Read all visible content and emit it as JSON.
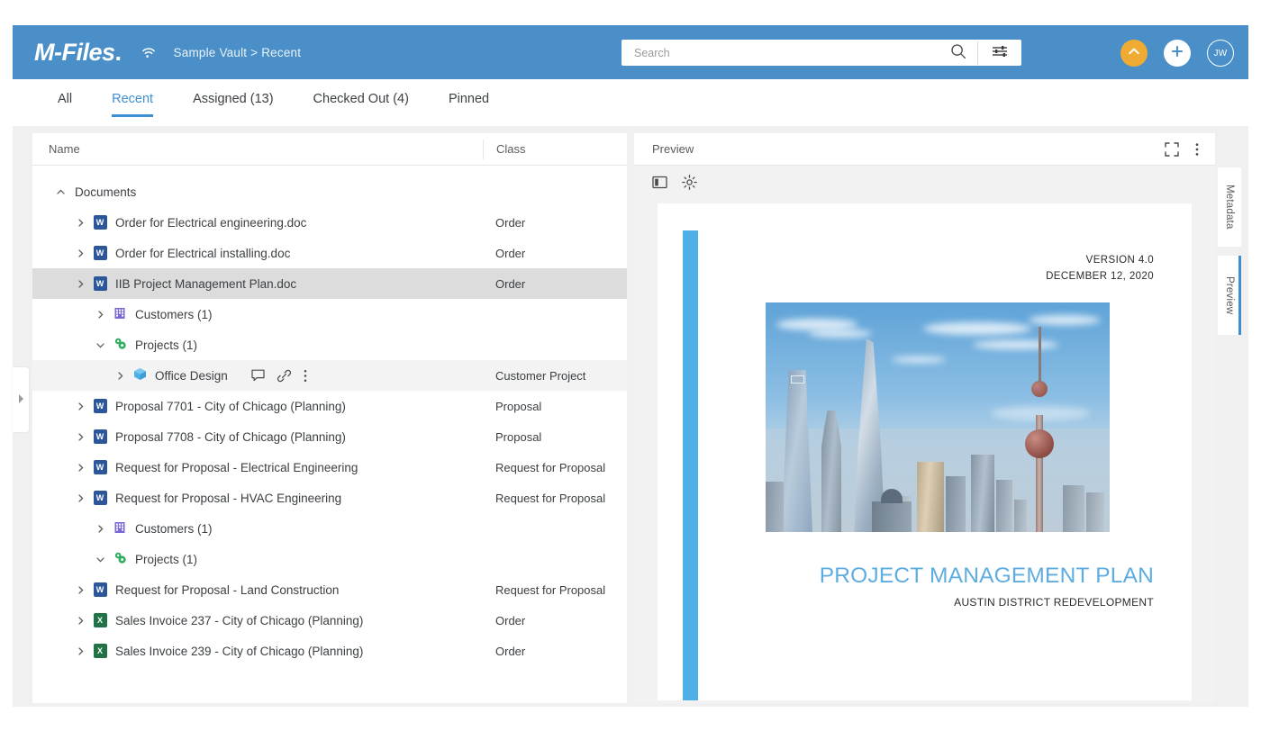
{
  "header": {
    "logo": "M-Files",
    "logo_dot": ".",
    "wifi_icon": "wifi-icon",
    "breadcrumb": "Sample Vault > Recent",
    "brand_color": "#4a8fc8"
  },
  "search": {
    "placeholder": "Search",
    "value": "",
    "search_icon": "search-icon",
    "filter_icon": "filter-sliders-icon"
  },
  "actions": {
    "upload_icon": "chevron-up-circle-icon",
    "add_icon": "plus-icon",
    "avatar_initials": "JW",
    "amber_color": "#f0ab32"
  },
  "tabs": [
    {
      "label": "All",
      "active": false
    },
    {
      "label": "Recent",
      "active": true
    },
    {
      "label": "Assigned (13)",
      "active": false
    },
    {
      "label": "Checked Out (4)",
      "active": false
    },
    {
      "label": "Pinned",
      "active": false
    }
  ],
  "list": {
    "columns": {
      "name": "Name",
      "class": "Class"
    },
    "rows": [
      {
        "label": "Documents",
        "class": "",
        "indent": 0,
        "chevron": "^",
        "icon": "none",
        "state": "normal"
      },
      {
        "label": "Order for Electrical engineering.doc",
        "class": "Order",
        "indent": 1,
        "chevron": ">",
        "icon": "word",
        "state": "normal"
      },
      {
        "label": "Order for Electrical installing.doc",
        "class": "Order",
        "indent": 1,
        "chevron": ">",
        "icon": "word",
        "state": "normal"
      },
      {
        "label": "IIB Project Management Plan.doc",
        "class": "Order",
        "indent": 1,
        "chevron": ">",
        "icon": "word",
        "state": "selected"
      },
      {
        "label": "Customers (1)",
        "class": "",
        "indent": 2,
        "chevron": ">",
        "icon": "customers",
        "state": "normal"
      },
      {
        "label": "Projects (1)",
        "class": "",
        "indent": 2,
        "chevron": "v",
        "icon": "projects",
        "state": "normal"
      },
      {
        "label": "Office Design",
        "class": "Customer Project",
        "indent": 3,
        "chevron": ">",
        "icon": "cube",
        "state": "subselected",
        "actions": [
          "comment-icon",
          "link-icon",
          "more-options-icon"
        ]
      },
      {
        "label": "Proposal 7701 - City of Chicago (Planning)",
        "class": "Proposal",
        "indent": 1,
        "chevron": ">",
        "icon": "word",
        "state": "normal"
      },
      {
        "label": "Proposal 7708 - City of Chicago (Planning)",
        "class": "Proposal",
        "indent": 1,
        "chevron": ">",
        "icon": "word",
        "state": "normal"
      },
      {
        "label": "Request for Proposal - Electrical Engineering",
        "class": "Request for Proposal",
        "indent": 1,
        "chevron": ">",
        "icon": "word",
        "state": "normal"
      },
      {
        "label": "Request for Proposal - HVAC Engineering",
        "class": "Request for Proposal",
        "indent": 1,
        "chevron": ">",
        "icon": "word",
        "state": "normal"
      },
      {
        "label": "Customers (1)",
        "class": "",
        "indent": 2,
        "chevron": ">",
        "icon": "customers",
        "state": "normal"
      },
      {
        "label": "Projects (1)",
        "class": "",
        "indent": 2,
        "chevron": "v",
        "icon": "projects",
        "state": "normal"
      },
      {
        "label": "Request for Proposal - Land Construction",
        "class": "Request for Proposal",
        "indent": 1,
        "chevron": ">",
        "icon": "word",
        "state": "normal"
      },
      {
        "label": "Sales Invoice 237 - City of Chicago (Planning)",
        "class": "Order",
        "indent": 1,
        "chevron": ">",
        "icon": "excel",
        "state": "normal"
      },
      {
        "label": "Sales Invoice 239 - City of Chicago (Planning)",
        "class": "Order",
        "indent": 1,
        "chevron": ">",
        "icon": "excel",
        "state": "normal"
      }
    ]
  },
  "preview": {
    "title": "Preview",
    "fullscreen_icon": "fullscreen-icon",
    "more_icon": "more-options-icon",
    "toolbar": {
      "panel_icon": "split-panel-icon",
      "settings_icon": "gear-icon"
    },
    "document": {
      "version": "VERSION 4.0",
      "date": "DECEMBER 12, 2020",
      "title": "PROJECT MANAGEMENT PLAN",
      "subtitle": "AUSTIN DISTRICT REDEVELOPMENT",
      "accent_color": "#4fb0e8",
      "title_color": "#5eade0",
      "photo_alt": "city-skyline-photo"
    }
  },
  "side_tabs": [
    {
      "label": "Metadata",
      "active": false
    },
    {
      "label": "Preview",
      "active": true
    }
  ],
  "left_handle": {
    "icon": "expand-right-triangle-icon"
  }
}
